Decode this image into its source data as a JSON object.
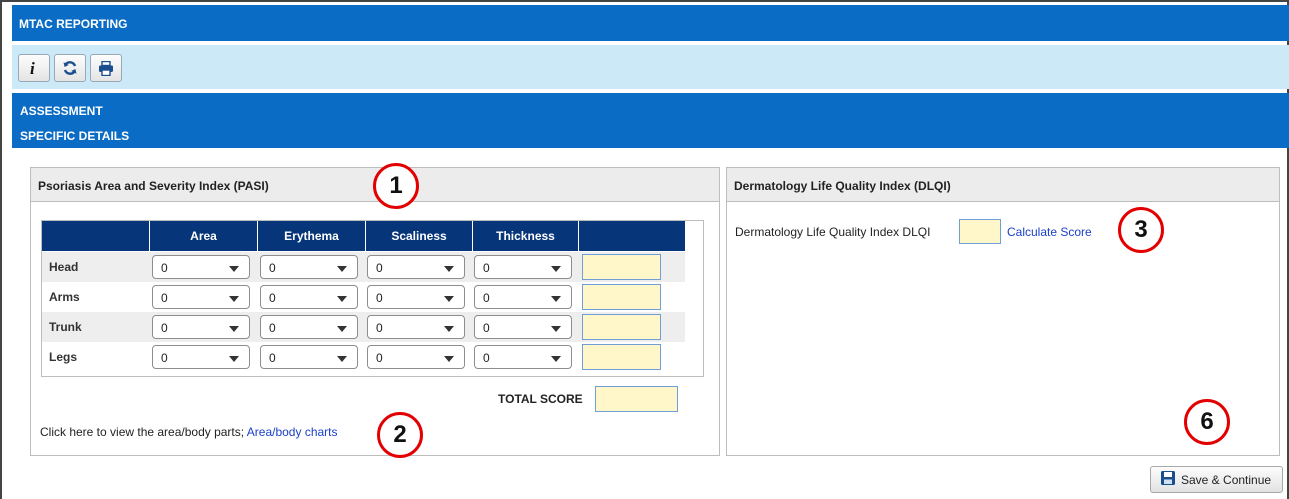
{
  "app": {
    "title": "MTAC REPORTING"
  },
  "toolbar": {
    "buttons": [
      {
        "icon": "info-icon"
      },
      {
        "icon": "refresh-icon"
      },
      {
        "icon": "print-icon"
      }
    ]
  },
  "section": {
    "line1": "ASSESSMENT",
    "line2": "SPECIFIC DETAILS"
  },
  "pasi": {
    "header": "Psoriasis Area and Severity Index (PASI)",
    "columns": [
      "Area",
      "Erythema",
      "Scaliness",
      "Thickness"
    ],
    "rows": [
      {
        "label": "Head",
        "values": [
          "0",
          "0",
          "0",
          "0"
        ],
        "score": ""
      },
      {
        "label": "Arms",
        "values": [
          "0",
          "0",
          "0",
          "0"
        ],
        "score": ""
      },
      {
        "label": "Trunk",
        "values": [
          "0",
          "0",
          "0",
          "0"
        ],
        "score": ""
      },
      {
        "label": "Legs",
        "values": [
          "0",
          "0",
          "0",
          "0"
        ],
        "score": ""
      }
    ],
    "total_label": "TOTAL SCORE",
    "total_value": "",
    "hint_text": "Click here to view the area/body parts;",
    "hint_link": "Area/body charts"
  },
  "dlqi": {
    "header": "Dermatology Life Quality Index (DLQI)",
    "field_label": "Dermatology Life Quality Index DLQI",
    "field_value": "",
    "calc_link": "Calculate Score"
  },
  "annotations": {
    "b1": "1",
    "b2": "2",
    "b3": "3",
    "b6": "6"
  },
  "actions": {
    "save_label": "Save & Continue"
  },
  "colors": {
    "primary": "#0a6cc4",
    "table_header": "#06357a",
    "toolbar_bg": "#cbe9f7",
    "score_fill": "#fff6c9",
    "annotation": "#e20000",
    "link": "#1a3fc9"
  }
}
